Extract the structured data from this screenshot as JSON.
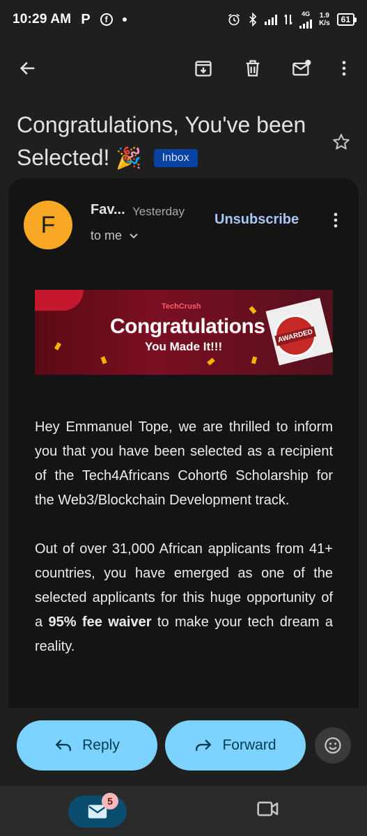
{
  "status_bar": {
    "time": "10:29 AM",
    "p_icon": "P",
    "fb_icon": "f",
    "network_label": "4G",
    "speed_value": "1.9",
    "speed_unit": "K/s",
    "battery": "61"
  },
  "email": {
    "subject": "Congratulations, You've been Selected!",
    "subject_emoji": "🎉",
    "label_chip": "Inbox",
    "avatar_letter": "F",
    "sender": "Fav...",
    "date": "Yesterday",
    "recipient": "to me",
    "unsubscribe_label": "Unsubscribe"
  },
  "banner": {
    "logo_text": "TechCrush",
    "title": "Congratulations",
    "subtitle": "You Made It!!!",
    "seal_text": "AWARDED"
  },
  "body": {
    "para1": "Hey Emmanuel Tope, we are thrilled to inform you that you have been selected as a recipient of the Tech4Africans Cohort6 Scholarship for the Web3/Blockchain Development track.",
    "para2_before": "Out of over 31,000 African applicants from 41+ countries, you have emerged as one of the selected applicants for this huge opportunity of a ",
    "para2_bold": "95% fee waiver",
    "para2_after": " to make your tech dream a reality."
  },
  "actions": {
    "reply_label": "Reply",
    "forward_label": "Forward"
  },
  "bottom_nav": {
    "mail_badge": "5"
  },
  "colors": {
    "background": "#1f1f1f",
    "card": "#141414",
    "action_button": "#7cd3ff",
    "avatar": "#f9a825",
    "chip": "#0842a0",
    "link": "#a8c7fa"
  }
}
